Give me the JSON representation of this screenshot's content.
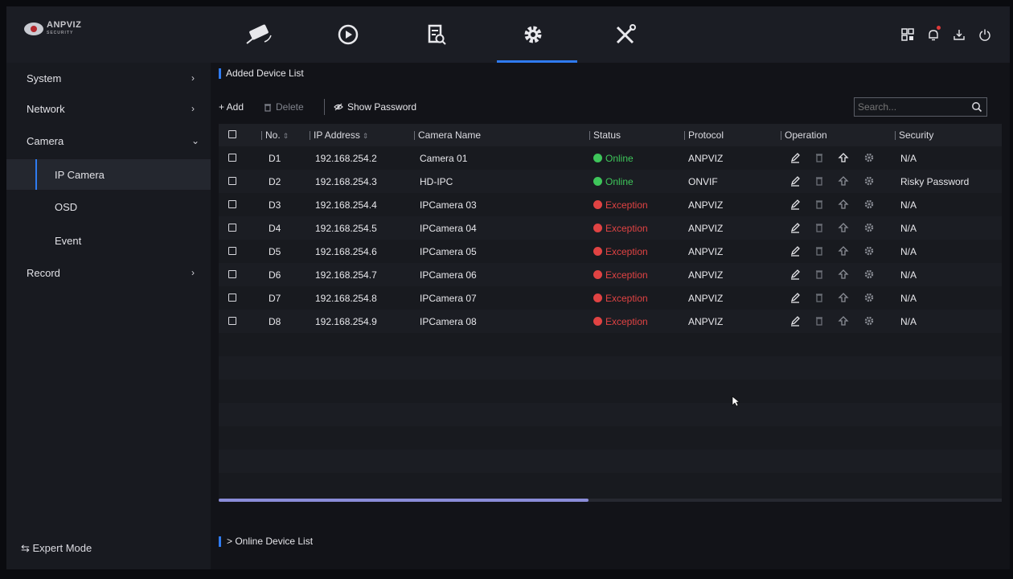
{
  "brand": {
    "name": "ANPVIZ",
    "tagline": "SECURITY",
    "accent": "#2f7bf0"
  },
  "nav": {
    "tabs": [
      {
        "icon": "camera-icon"
      },
      {
        "icon": "playback-icon"
      },
      {
        "icon": "search-file-icon"
      },
      {
        "icon": "gear-icon",
        "active": true
      },
      {
        "icon": "tools-icon"
      }
    ],
    "actions": [
      "qr-code-icon",
      "bell-icon",
      "download-icon",
      "power-icon"
    ]
  },
  "sidebar": {
    "items": [
      {
        "label": "System",
        "chevron": "›"
      },
      {
        "label": "Network",
        "chevron": "›"
      },
      {
        "label": "Camera",
        "chevron": "⌄"
      },
      {
        "label": "IP Camera",
        "sub": true,
        "active": true
      },
      {
        "label": "OSD",
        "sub": true
      },
      {
        "label": "Event",
        "sub": true
      },
      {
        "label": "Record",
        "chevron": "›"
      }
    ],
    "expert_mode": "⇆ Expert Mode"
  },
  "main": {
    "title": "Added Device List",
    "toolbar": {
      "add": "+ Add",
      "delete": "Delete",
      "show_password": "Show Password",
      "search_placeholder": "Search..."
    },
    "columns": {
      "no": "No.",
      "ip": "IP Address",
      "name": "Camera Name",
      "status": "Status",
      "protocol": "Protocol",
      "operation": "Operation",
      "security": "Security"
    },
    "rows": [
      {
        "no": "D1",
        "ip": "192.168.254.2",
        "name": "Camera 01",
        "status": "Online",
        "protocol": "ANPVIZ",
        "security": "N/A"
      },
      {
        "no": "D2",
        "ip": "192.168.254.3",
        "name": "HD-IPC",
        "status": "Online",
        "protocol": "ONVIF",
        "security": "Risky Password"
      },
      {
        "no": "D3",
        "ip": "192.168.254.4",
        "name": "IPCamera 03",
        "status": "Exception",
        "protocol": "ANPVIZ",
        "security": "N/A"
      },
      {
        "no": "D4",
        "ip": "192.168.254.5",
        "name": "IPCamera 04",
        "status": "Exception",
        "protocol": "ANPVIZ",
        "security": "N/A"
      },
      {
        "no": "D5",
        "ip": "192.168.254.6",
        "name": "IPCamera 05",
        "status": "Exception",
        "protocol": "ANPVIZ",
        "security": "N/A"
      },
      {
        "no": "D6",
        "ip": "192.168.254.7",
        "name": "IPCamera 06",
        "status": "Exception",
        "protocol": "ANPVIZ",
        "security": "N/A"
      },
      {
        "no": "D7",
        "ip": "192.168.254.8",
        "name": "IPCamera 07",
        "status": "Exception",
        "protocol": "ANPVIZ",
        "security": "N/A"
      },
      {
        "no": "D8",
        "ip": "192.168.254.9",
        "name": "IPCamera 08",
        "status": "Exception",
        "protocol": "ANPVIZ",
        "security": "N/A"
      }
    ],
    "status_colors": {
      "Online": "#3ec55a",
      "Exception": "#e04343"
    },
    "online_list": "> Online Device List"
  }
}
